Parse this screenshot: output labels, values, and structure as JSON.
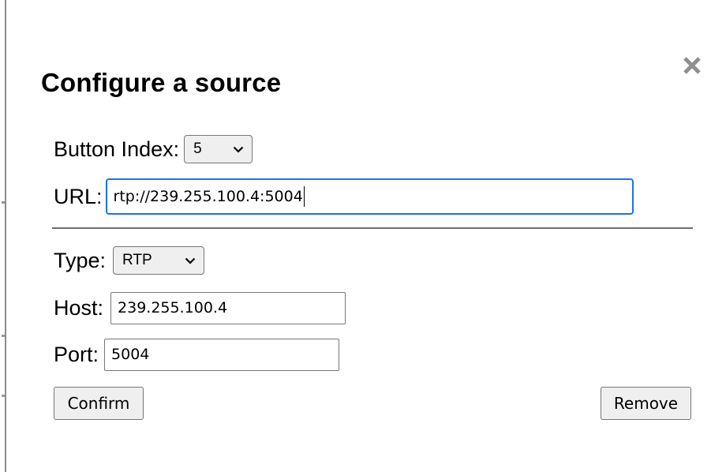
{
  "dialog": {
    "title": "Configure a source",
    "close_icon": "close-icon"
  },
  "form": {
    "button_index": {
      "label": "Button Index:",
      "selected": "5"
    },
    "url": {
      "label": "URL:",
      "value": "rtp://239.255.100.4:5004"
    },
    "type": {
      "label": "Type:",
      "selected": "RTP"
    },
    "host": {
      "label": "Host:",
      "value": "239.255.100.4"
    },
    "port": {
      "label": "Port:",
      "value": "5004"
    }
  },
  "actions": {
    "confirm_label": "Confirm",
    "remove_label": "Remove"
  },
  "colors": {
    "focus_ring": "#1a73e8",
    "control_bg": "#efefef",
    "control_border": "#767676"
  }
}
